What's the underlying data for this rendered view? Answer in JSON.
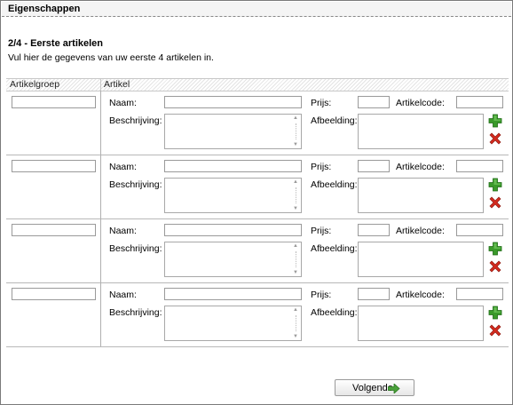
{
  "window": {
    "title": "Eigenschappen"
  },
  "page": {
    "heading": "2/4 - Eerste artikelen",
    "intro": "Vul hier de gegevens van uw eerste 4 artikelen in."
  },
  "table": {
    "columns": [
      "Artikelgroep",
      "Artikel"
    ],
    "labels": {
      "name": "Naam:",
      "price": "Prijs:",
      "code": "Artikelcode:",
      "description": "Beschrijving:",
      "image": "Afbeelding:"
    },
    "rows": [
      {
        "group": "",
        "name": "",
        "price": "",
        "code": "",
        "description": ""
      },
      {
        "group": "",
        "name": "",
        "price": "",
        "code": "",
        "description": ""
      },
      {
        "group": "",
        "name": "",
        "price": "",
        "code": "",
        "description": ""
      },
      {
        "group": "",
        "name": "",
        "price": "",
        "code": "",
        "description": ""
      }
    ]
  },
  "icons": {
    "add": "plus-icon",
    "delete": "cross-icon",
    "next": "arrow-right-icon"
  },
  "colors": {
    "add_green": "#3a9a2a",
    "delete_red": "#d42a1e",
    "next_arrow": "#4aa03a"
  },
  "footer": {
    "next_label": "Volgende"
  }
}
